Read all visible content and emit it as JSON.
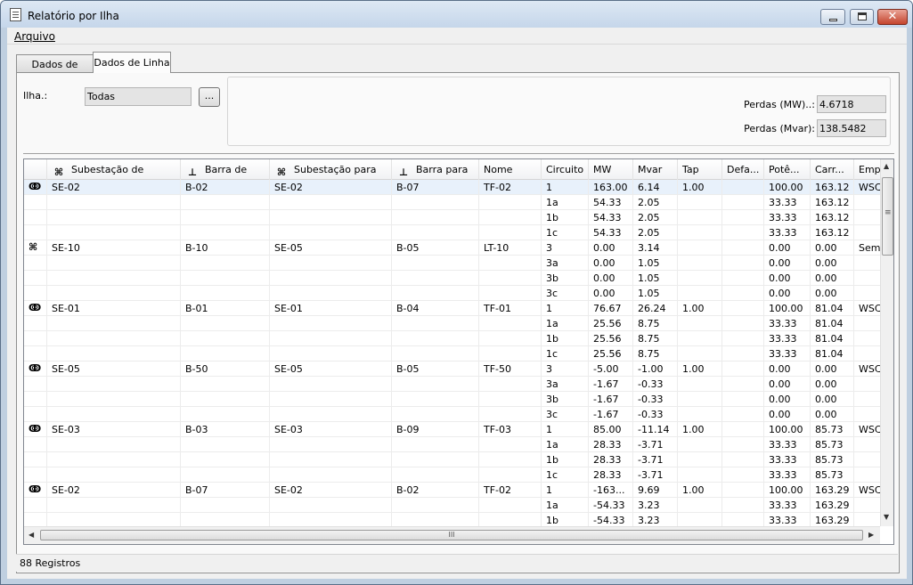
{
  "window": {
    "title": "Relatório por Ilha",
    "close_glyph": "✕"
  },
  "menu": {
    "arquivo": "Arquivo"
  },
  "tabs": [
    {
      "label": "Dados de Barra"
    },
    {
      "label": "Dados de Linha"
    }
  ],
  "filter": {
    "ilha_label": "Ilha.:",
    "ilha_value": "Todas",
    "browse_label": "..."
  },
  "perdas": {
    "mw_label": "Perdas (MW)..:",
    "mw_value": "4.6718",
    "mvar_label": "Perdas (Mvar):",
    "mvar_value": "138.5482"
  },
  "grid": {
    "columns": [
      {
        "key": "icon",
        "label": "",
        "icon": ""
      },
      {
        "key": "sub_de",
        "label": "Subestação de",
        "icon": "substation-icon"
      },
      {
        "key": "barra_de",
        "label": "Barra de",
        "icon": "bus-icon"
      },
      {
        "key": "sub_para",
        "label": "Subestação para",
        "icon": "substation-icon"
      },
      {
        "key": "barra_para",
        "label": "Barra para",
        "icon": "bus-icon"
      },
      {
        "key": "nome",
        "label": "Nome",
        "icon": ""
      },
      {
        "key": "circuito",
        "label": "Circuito",
        "icon": ""
      },
      {
        "key": "mw",
        "label": "MW",
        "icon": ""
      },
      {
        "key": "mvar",
        "label": "Mvar",
        "icon": ""
      },
      {
        "key": "tap",
        "label": "Tap",
        "icon": ""
      },
      {
        "key": "defa",
        "label": "Defa...",
        "icon": ""
      },
      {
        "key": "pot",
        "label": "Potê...",
        "icon": ""
      },
      {
        "key": "carr",
        "label": "Carr...",
        "icon": ""
      },
      {
        "key": "emp",
        "label": "Emp",
        "icon": ""
      }
    ],
    "rows": [
      {
        "icon": "transformer-icon",
        "sub_de": "SE-02",
        "barra_de": "B-02",
        "sub_para": "SE-02",
        "barra_para": "B-07",
        "nome": "TF-02",
        "circuito": "1",
        "mw": "163.00",
        "mvar": "6.14",
        "tap": "1.00",
        "defa": "",
        "pot": "100.00",
        "carr": "163.12",
        "emp": "WSC",
        "selected": true
      },
      {
        "icon": "",
        "sub_de": "",
        "barra_de": "",
        "sub_para": "",
        "barra_para": "",
        "nome": "",
        "circuito": "1a",
        "mw": "54.33",
        "mvar": "2.05",
        "tap": "",
        "defa": "",
        "pot": "33.33",
        "carr": "163.12",
        "emp": ""
      },
      {
        "icon": "",
        "sub_de": "",
        "barra_de": "",
        "sub_para": "",
        "barra_para": "",
        "nome": "",
        "circuito": "1b",
        "mw": "54.33",
        "mvar": "2.05",
        "tap": "",
        "defa": "",
        "pot": "33.33",
        "carr": "163.12",
        "emp": ""
      },
      {
        "icon": "",
        "sub_de": "",
        "barra_de": "",
        "sub_para": "",
        "barra_para": "",
        "nome": "",
        "circuito": "1c",
        "mw": "54.33",
        "mvar": "2.05",
        "tap": "",
        "defa": "",
        "pot": "33.33",
        "carr": "163.12",
        "emp": ""
      },
      {
        "icon": "tower-icon",
        "sub_de": "SE-10",
        "barra_de": "B-10",
        "sub_para": "SE-05",
        "barra_para": "B-05",
        "nome": "LT-10",
        "circuito": "3",
        "mw": "0.00",
        "mvar": "3.14",
        "tap": "",
        "defa": "",
        "pot": "0.00",
        "carr": "0.00",
        "emp": "Sem"
      },
      {
        "icon": "",
        "sub_de": "",
        "barra_de": "",
        "sub_para": "",
        "barra_para": "",
        "nome": "",
        "circuito": "3a",
        "mw": "0.00",
        "mvar": "1.05",
        "tap": "",
        "defa": "",
        "pot": "0.00",
        "carr": "0.00",
        "emp": ""
      },
      {
        "icon": "",
        "sub_de": "",
        "barra_de": "",
        "sub_para": "",
        "barra_para": "",
        "nome": "",
        "circuito": "3b",
        "mw": "0.00",
        "mvar": "1.05",
        "tap": "",
        "defa": "",
        "pot": "0.00",
        "carr": "0.00",
        "emp": ""
      },
      {
        "icon": "",
        "sub_de": "",
        "barra_de": "",
        "sub_para": "",
        "barra_para": "",
        "nome": "",
        "circuito": "3c",
        "mw": "0.00",
        "mvar": "1.05",
        "tap": "",
        "defa": "",
        "pot": "0.00",
        "carr": "0.00",
        "emp": ""
      },
      {
        "icon": "transformer-icon",
        "sub_de": "SE-01",
        "barra_de": "B-01",
        "sub_para": "SE-01",
        "barra_para": "B-04",
        "nome": "TF-01",
        "circuito": "1",
        "mw": "76.67",
        "mvar": "26.24",
        "tap": "1.00",
        "defa": "",
        "pot": "100.00",
        "carr": "81.04",
        "emp": "WSC"
      },
      {
        "icon": "",
        "sub_de": "",
        "barra_de": "",
        "sub_para": "",
        "barra_para": "",
        "nome": "",
        "circuito": "1a",
        "mw": "25.56",
        "mvar": "8.75",
        "tap": "",
        "defa": "",
        "pot": "33.33",
        "carr": "81.04",
        "emp": ""
      },
      {
        "icon": "",
        "sub_de": "",
        "barra_de": "",
        "sub_para": "",
        "barra_para": "",
        "nome": "",
        "circuito": "1b",
        "mw": "25.56",
        "mvar": "8.75",
        "tap": "",
        "defa": "",
        "pot": "33.33",
        "carr": "81.04",
        "emp": ""
      },
      {
        "icon": "",
        "sub_de": "",
        "barra_de": "",
        "sub_para": "",
        "barra_para": "",
        "nome": "",
        "circuito": "1c",
        "mw": "25.56",
        "mvar": "8.75",
        "tap": "",
        "defa": "",
        "pot": "33.33",
        "carr": "81.04",
        "emp": ""
      },
      {
        "icon": "transformer-icon",
        "sub_de": "SE-05",
        "barra_de": "B-50",
        "sub_para": "SE-05",
        "barra_para": "B-05",
        "nome": "TF-50",
        "circuito": "3",
        "mw": "-5.00",
        "mvar": "-1.00",
        "tap": "1.00",
        "defa": "",
        "pot": "0.00",
        "carr": "0.00",
        "emp": "WSC"
      },
      {
        "icon": "",
        "sub_de": "",
        "barra_de": "",
        "sub_para": "",
        "barra_para": "",
        "nome": "",
        "circuito": "3a",
        "mw": "-1.67",
        "mvar": "-0.33",
        "tap": "",
        "defa": "",
        "pot": "0.00",
        "carr": "0.00",
        "emp": ""
      },
      {
        "icon": "",
        "sub_de": "",
        "barra_de": "",
        "sub_para": "",
        "barra_para": "",
        "nome": "",
        "circuito": "3b",
        "mw": "-1.67",
        "mvar": "-0.33",
        "tap": "",
        "defa": "",
        "pot": "0.00",
        "carr": "0.00",
        "emp": ""
      },
      {
        "icon": "",
        "sub_de": "",
        "barra_de": "",
        "sub_para": "",
        "barra_para": "",
        "nome": "",
        "circuito": "3c",
        "mw": "-1.67",
        "mvar": "-0.33",
        "tap": "",
        "defa": "",
        "pot": "0.00",
        "carr": "0.00",
        "emp": ""
      },
      {
        "icon": "transformer-icon",
        "sub_de": "SE-03",
        "barra_de": "B-03",
        "sub_para": "SE-03",
        "barra_para": "B-09",
        "nome": "TF-03",
        "circuito": "1",
        "mw": "85.00",
        "mvar": "-11.14",
        "tap": "1.00",
        "defa": "",
        "pot": "100.00",
        "carr": "85.73",
        "emp": "WSC"
      },
      {
        "icon": "",
        "sub_de": "",
        "barra_de": "",
        "sub_para": "",
        "barra_para": "",
        "nome": "",
        "circuito": "1a",
        "mw": "28.33",
        "mvar": "-3.71",
        "tap": "",
        "defa": "",
        "pot": "33.33",
        "carr": "85.73",
        "emp": ""
      },
      {
        "icon": "",
        "sub_de": "",
        "barra_de": "",
        "sub_para": "",
        "barra_para": "",
        "nome": "",
        "circuito": "1b",
        "mw": "28.33",
        "mvar": "-3.71",
        "tap": "",
        "defa": "",
        "pot": "33.33",
        "carr": "85.73",
        "emp": ""
      },
      {
        "icon": "",
        "sub_de": "",
        "barra_de": "",
        "sub_para": "",
        "barra_para": "",
        "nome": "",
        "circuito": "1c",
        "mw": "28.33",
        "mvar": "-3.71",
        "tap": "",
        "defa": "",
        "pot": "33.33",
        "carr": "85.73",
        "emp": ""
      },
      {
        "icon": "transformer-icon",
        "sub_de": "SE-02",
        "barra_de": "B-07",
        "sub_para": "SE-02",
        "barra_para": "B-02",
        "nome": "TF-02",
        "circuito": "1",
        "mw": "-163...",
        "mvar": "9.69",
        "tap": "1.00",
        "defa": "",
        "pot": "100.00",
        "carr": "163.29",
        "emp": "WSC"
      },
      {
        "icon": "",
        "sub_de": "",
        "barra_de": "",
        "sub_para": "",
        "barra_para": "",
        "nome": "",
        "circuito": "1a",
        "mw": "-54.33",
        "mvar": "3.23",
        "tap": "",
        "defa": "",
        "pot": "33.33",
        "carr": "163.29",
        "emp": ""
      },
      {
        "icon": "",
        "sub_de": "",
        "barra_de": "",
        "sub_para": "",
        "barra_para": "",
        "nome": "",
        "circuito": "1b",
        "mw": "-54.33",
        "mvar": "3.23",
        "tap": "",
        "defa": "",
        "pot": "33.33",
        "carr": "163.29",
        "emp": ""
      }
    ]
  },
  "scroll": {
    "up": "▲",
    "down": "▼",
    "left": "◀",
    "right": "▶",
    "grip": "III"
  },
  "status": {
    "text": "88 Registros"
  }
}
